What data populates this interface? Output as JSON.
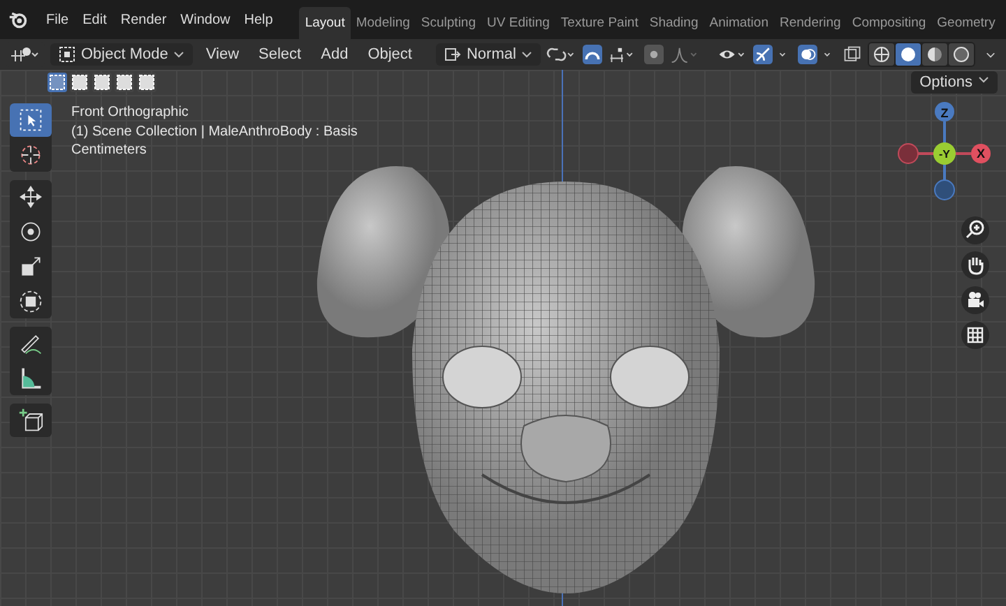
{
  "menu": [
    "File",
    "Edit",
    "Render",
    "Window",
    "Help"
  ],
  "workspaces": [
    {
      "label": "Layout",
      "selected": true
    },
    {
      "label": "Modeling",
      "selected": false
    },
    {
      "label": "Sculpting",
      "selected": false
    },
    {
      "label": "UV Editing",
      "selected": false
    },
    {
      "label": "Texture Paint",
      "selected": false
    },
    {
      "label": "Shading",
      "selected": false
    },
    {
      "label": "Animation",
      "selected": false
    },
    {
      "label": "Rendering",
      "selected": false
    },
    {
      "label": "Compositing",
      "selected": false
    },
    {
      "label": "Geometry",
      "selected": false
    }
  ],
  "header": {
    "mode": "Object Mode",
    "menus": [
      "View",
      "Select",
      "Add",
      "Object"
    ],
    "orientation": "Normal"
  },
  "select_modes": [
    {
      "selected": true
    },
    {
      "selected": false
    },
    {
      "selected": false
    },
    {
      "selected": false
    },
    {
      "selected": false
    }
  ],
  "shading": [
    {
      "kind": "wireframe",
      "selected": false
    },
    {
      "kind": "solid",
      "selected": true
    },
    {
      "kind": "material",
      "selected": false
    },
    {
      "kind": "rendered",
      "selected": false
    }
  ],
  "options": "Options",
  "overlay_text": [
    "Front Orthographic",
    "(1) Scene Collection | MaleAnthroBody : Basis",
    "Centimeters"
  ],
  "toolbar": [
    [
      {
        "kind": "select",
        "selected": true
      },
      {
        "kind": "cursor",
        "selected": false
      }
    ],
    [
      {
        "kind": "move",
        "selected": false
      },
      {
        "kind": "rotate",
        "selected": false
      },
      {
        "kind": "scale",
        "selected": false
      },
      {
        "kind": "transform",
        "selected": false
      }
    ],
    [
      {
        "kind": "annotate",
        "selected": false
      },
      {
        "kind": "measure",
        "selected": false
      }
    ],
    [
      {
        "kind": "add-cube",
        "selected": false
      }
    ]
  ],
  "gizmo": {
    "z": "Z",
    "y": "-Y",
    "x": "X"
  }
}
